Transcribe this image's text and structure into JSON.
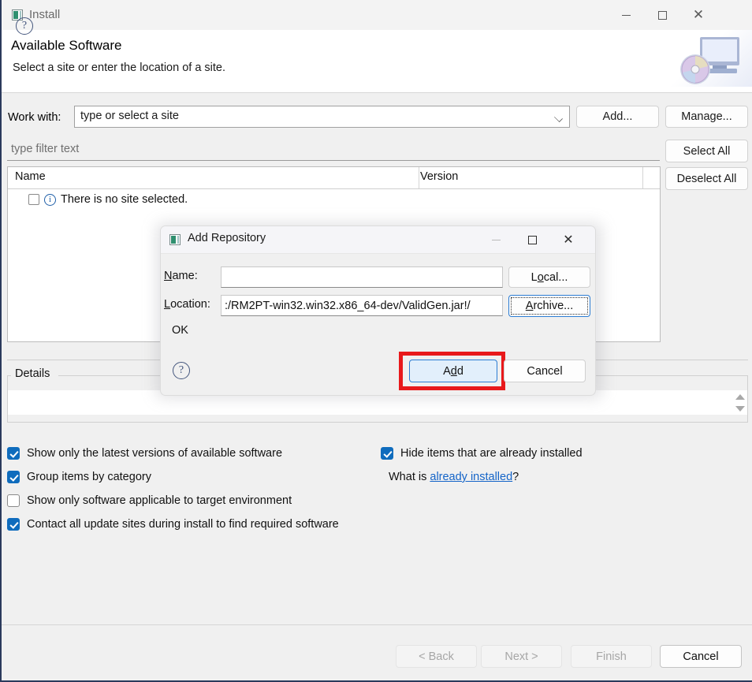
{
  "window": {
    "title": "Install",
    "icon": "eclipse-install-icon",
    "controls": {
      "minimize": "minimize-icon",
      "maximize": "maximize-icon",
      "close": "close-icon"
    }
  },
  "header": {
    "title": "Available Software",
    "subtitle": "Select a site or enter the location of a site.",
    "banner_icon": "monitor-with-disc-icon"
  },
  "work_with": {
    "label": "Work with:",
    "value": "type or select a site",
    "dropdown_icon": "chevron-down-icon",
    "add_label": "Add...",
    "manage_label": "Manage..."
  },
  "filter": {
    "placeholder": "type filter text"
  },
  "side_buttons": {
    "select_all": "Select All",
    "deselect_all": "Deselect All"
  },
  "tree": {
    "columns": [
      "Name",
      "Version"
    ],
    "rows": [
      {
        "checked": false,
        "icon": "info-icon",
        "label": "There is no site selected."
      }
    ]
  },
  "details": {
    "legend": "Details",
    "value": "",
    "spinner_icon": "spinner-arrows-icon"
  },
  "options": [
    {
      "label": "Show only the latest versions of available software",
      "checked": true
    },
    {
      "label": "Group items by category",
      "checked": true
    },
    {
      "label": "Show only software applicable to target environment",
      "checked": false
    },
    {
      "label": "Contact all update sites during install to find required software",
      "checked": true
    },
    {
      "label": "Hide items that are already installed",
      "checked": true
    }
  ],
  "what_is": {
    "prefix": "What is ",
    "link": "already installed",
    "suffix": "?"
  },
  "footer": {
    "help_icon": "help-icon",
    "buttons": [
      {
        "label": "< Back",
        "enabled": false
      },
      {
        "label": "Next >",
        "enabled": false
      },
      {
        "label": "Finish",
        "enabled": false
      },
      {
        "label": "Cancel",
        "enabled": true
      }
    ]
  },
  "dialog": {
    "title": "Add Repository",
    "icon": "eclipse-install-icon",
    "controls": {
      "minimize": "minimize-icon",
      "maximize": "maximize-icon",
      "close": "close-icon"
    },
    "name_label": "Name:",
    "name_mnemonic": "N",
    "name_value": "",
    "location_label": "Location:",
    "location_mnemonic": "L",
    "location_value": ":/RM2PT-win32.win32.x86_64-dev/ValidGen.jar!/",
    "status": "OK",
    "local_label_pre": "L",
    "local_mnemonic": "o",
    "local_label_post": "cal...",
    "archive_mnemonic": "A",
    "archive_label_post": "rchive...",
    "add_label_pre": "A",
    "add_mnemonic": "d",
    "add_label_post": "d",
    "cancel_label": "Cancel",
    "help_icon": "help-icon",
    "highlight_color": "#e8191b"
  }
}
